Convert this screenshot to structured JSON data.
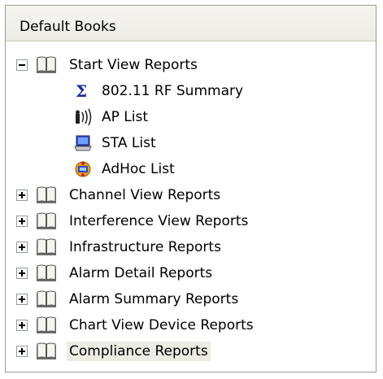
{
  "header": {
    "title": "Default Books"
  },
  "tree": {
    "expanded_group": {
      "label": "Start View Reports",
      "children": [
        {
          "label": "802.11 RF Summary",
          "icon": "sigma-icon"
        },
        {
          "label": "AP List",
          "icon": "access-point-icon"
        },
        {
          "label": "STA List",
          "icon": "laptop-icon"
        },
        {
          "label": "AdHoc List",
          "icon": "adhoc-icon"
        }
      ]
    },
    "collapsed_groups": [
      "Channel View Reports",
      "Interference View Reports",
      "Infrastructure Reports",
      "Alarm Detail Reports",
      "Alarm Summary Reports",
      "Chart View Device Reports",
      "Compliance Reports"
    ],
    "selected": "Compliance Reports"
  }
}
